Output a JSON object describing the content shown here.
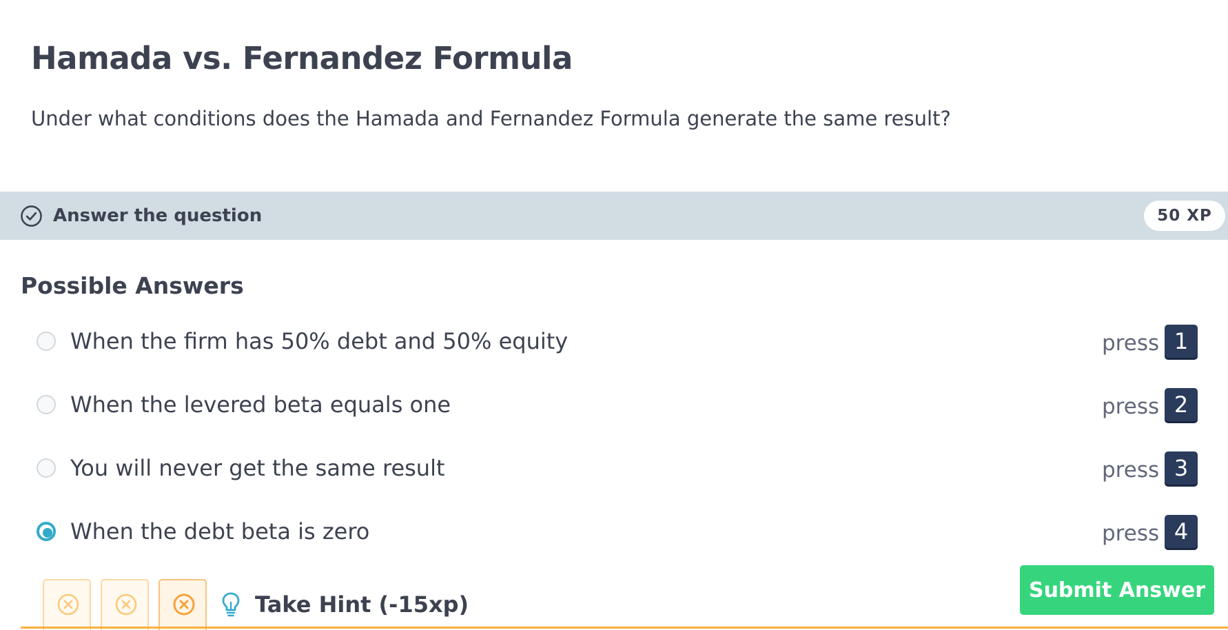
{
  "exercise": {
    "title": "Hamada vs. Fernandez Formula",
    "question": "Under what conditions does the Hamada and Fernandez Formula generate the same result?"
  },
  "task_bar": {
    "label": "Answer the question",
    "xp": "50 XP",
    "icon": "check-circle-icon"
  },
  "answers": {
    "heading": "Possible Answers",
    "press_label": "press",
    "selected_index": 3,
    "options": [
      {
        "text": "When the firm has 50% debt and 50% equity",
        "key": "1"
      },
      {
        "text": "When the levered beta equals one",
        "key": "2"
      },
      {
        "text": "You will never get the same result",
        "key": "3"
      },
      {
        "text": "When the debt beta is zero",
        "key": "4"
      }
    ]
  },
  "actions": {
    "submit_label": "Submit Answer",
    "hint_label": "Take Hint (-15xp)",
    "hint_icon": "lightbulb-icon",
    "attempt_icon": "x-circle-icon"
  },
  "colors": {
    "accent_blue": "#33aacc",
    "submit_green": "#36d57d",
    "key_navy": "#2a3b5c",
    "attempt_orange": "#fbb040",
    "task_bar_bg": "#d1dce3"
  }
}
